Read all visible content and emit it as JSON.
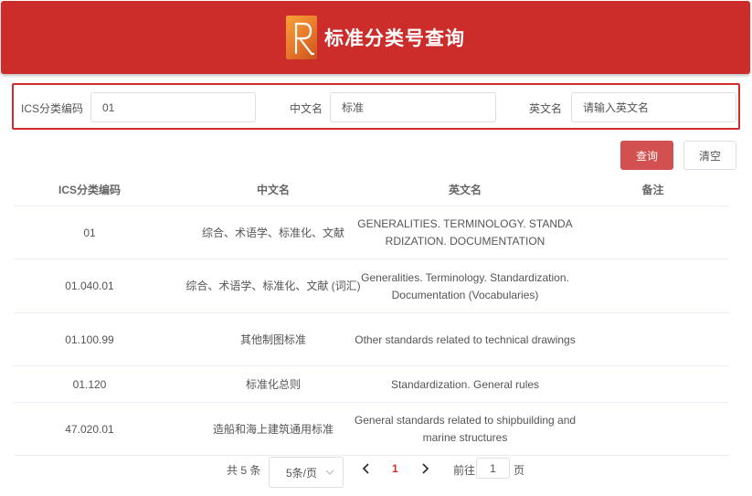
{
  "header": {
    "title": "标准分类号查询"
  },
  "search": {
    "ics_label": "ICS分类编码",
    "ics_value": "01",
    "cn_label": "中文名",
    "cn_value": "标准",
    "en_label": "英文名",
    "en_placeholder": "请输入英文名",
    "query_button": "查询",
    "clear_button": "清空"
  },
  "table": {
    "headers": [
      "ICS分类编码",
      "中文名",
      "英文名",
      "备注"
    ],
    "rows": [
      {
        "code": "01",
        "cn": "综合、术语学、标准化、文献",
        "en": "GENERALITIES. TERMINOLOGY. STANDARDIZATION. DOCUMENTATION",
        "note": ""
      },
      {
        "code": "01.040.01",
        "cn": "综合、术语学、标准化、文献 (词汇)",
        "en": "Generalities. Terminology. Standardization. Documentation (Vocabularies)",
        "note": ""
      },
      {
        "code": "01.100.99",
        "cn": "其他制图标准",
        "en": "Other standards related to technical drawings",
        "note": ""
      },
      {
        "code": "01.120",
        "cn": "标准化总则",
        "en": "Standardization. General rules",
        "note": ""
      },
      {
        "code": "47.020.01",
        "cn": "造船和海上建筑通用标准",
        "en": "General standards related to shipbuilding and marine structures",
        "note": ""
      }
    ]
  },
  "pagination": {
    "total_text": "共 5 条",
    "page_size": "5条/页",
    "prev_icon": "chevron-left-icon",
    "current_page": "1",
    "next_icon": "chevron-right-icon",
    "goto_label": "前往",
    "goto_value": "1",
    "page_unit": "页"
  },
  "colors": {
    "header_bg": "#cc2d2b",
    "highlight_border": "#d32a2a",
    "query_button": "#d2504f",
    "active_page": "#d32a2a"
  }
}
